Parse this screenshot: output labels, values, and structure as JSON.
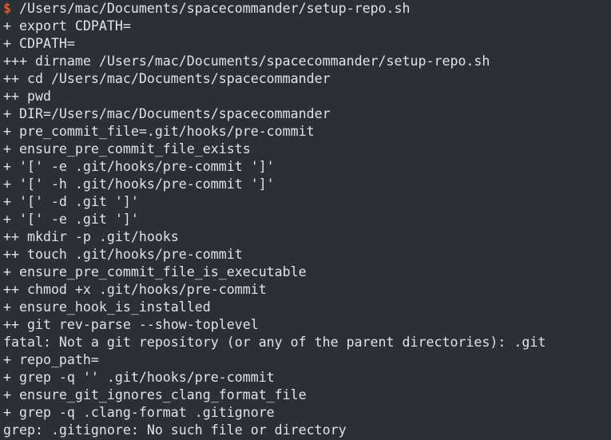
{
  "terminal": {
    "prompt_symbol": "$",
    "command": " /Users/mac/Documents/spacecommander/setup-repo.sh",
    "lines": [
      "+ export CDPATH=",
      "+ CDPATH=",
      "+++ dirname /Users/mac/Documents/spacecommander/setup-repo.sh",
      "++ cd /Users/mac/Documents/spacecommander",
      "++ pwd",
      "+ DIR=/Users/mac/Documents/spacecommander",
      "+ pre_commit_file=.git/hooks/pre-commit",
      "+ ensure_pre_commit_file_exists",
      "+ '[' -e .git/hooks/pre-commit ']'",
      "+ '[' -h .git/hooks/pre-commit ']'",
      "+ '[' -d .git ']'",
      "+ '[' -e .git ']'",
      "++ mkdir -p .git/hooks",
      "++ touch .git/hooks/pre-commit",
      "+ ensure_pre_commit_file_is_executable",
      "++ chmod +x .git/hooks/pre-commit",
      "+ ensure_hook_is_installed",
      "++ git rev-parse --show-toplevel",
      "fatal: Not a git repository (or any of the parent directories): .git",
      "+ repo_path=",
      "+ grep -q '' .git/hooks/pre-commit",
      "+ ensure_git_ignores_clang_format_file",
      "+ grep -q .clang-format .gitignore",
      "grep: .gitignore: No such file or directory"
    ],
    "colors": {
      "background": "#2a3036",
      "text": "#dfe3e6",
      "prompt": "#e4572e"
    }
  }
}
